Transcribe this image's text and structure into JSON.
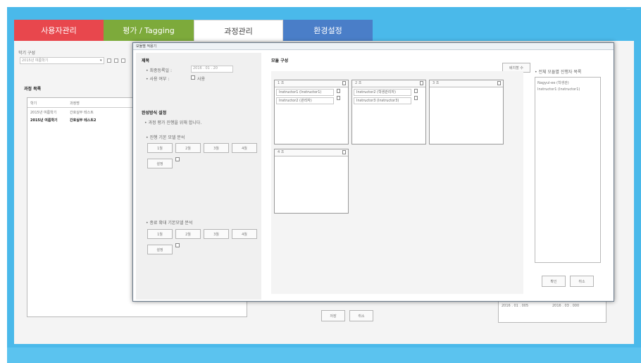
{
  "tabs": [
    {
      "label": "사용자관리",
      "color": "#e8474d"
    },
    {
      "label": "평가 / Tagging",
      "color": "#7daa3b"
    },
    {
      "label": "과정관리",
      "color": "#ffffff"
    },
    {
      "label": "환경설정",
      "color": "#4a7ec8"
    }
  ],
  "corner_mark": "—",
  "left_panel": {
    "term_label": "학기 구성",
    "term_select": "2015년 여름학기",
    "list_title": "과정 목록",
    "columns": [
      "학기",
      "과정명"
    ],
    "rows": [
      {
        "term": "2015년 여름학기",
        "name": "간호실무 테스트"
      },
      {
        "term": "2015년 여름학기",
        "name": "간호실무 테스트2"
      }
    ]
  },
  "bottom_dates": [
    "2016 . 01 . 005",
    "2016 . 03 . 000"
  ],
  "bottom_buttons": [
    "저장",
    "취소"
  ],
  "dialog": {
    "title": "모듈별 적용기",
    "section1": {
      "title": "제목",
      "reg_date_label": "• 최종등록일 :",
      "reg_date_value": "2016 . 01 . 20",
      "use_label": "• 사용 여부 :",
      "use_value": "사용"
    },
    "section2": {
      "title": "완성방식 설정",
      "desc": "• 과정 평가 진행을 위해 합니다.",
      "sub1": "• 진행 기본 모델 분석",
      "buttons1": [
        "1월",
        "2월",
        "3월",
        "4월"
      ],
      "sub1_btn": "설정",
      "sub2": "• 종료 확대 기본모델 분석",
      "buttons2": [
        "1월",
        "2월",
        "3월",
        "4월"
      ],
      "sub2_btn": "설정"
    },
    "mid_title": "모듈 구성",
    "add_button": "배치할 수",
    "groups": [
      {
        "header": "1 조",
        "items": [
          "Instructor1 (Instructor1)",
          "Instructor2 (관리자)"
        ]
      },
      {
        "header": "2 조",
        "items": [
          "Instructor2 (학생관리자)",
          "Instructor3 (Instructor3)"
        ]
      },
      {
        "header": "3 조",
        "items": []
      },
      {
        "header": "4 조",
        "items": []
      }
    ],
    "right_title": "• 전체 모듈별 진행자 목록",
    "right_items": [
      "Nagyul-ee (학생관)",
      "Instructor1 (Instructor1)"
    ],
    "ok_button": "확인",
    "cancel_button": "취소"
  }
}
